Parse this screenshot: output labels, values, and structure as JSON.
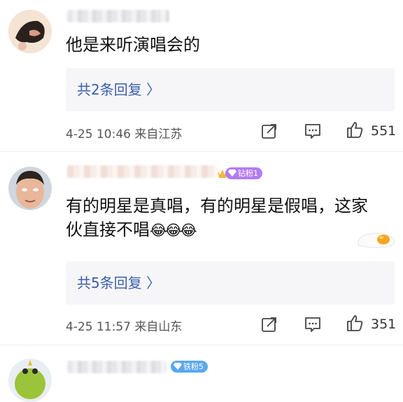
{
  "comments": [
    {
      "text": "他是来听演唱会的",
      "replies": "共2条回复 〉",
      "meta": "4-25 10:46 来自江苏",
      "likes": "551"
    },
    {
      "text_line1": "有的明星是真唱，有的明星是假唱，这家",
      "text_line2": "伙直接不唱",
      "emoji": "😂😂😂",
      "badge": "钻粉1",
      "replies": "共5条回复 〉",
      "meta": "4-25 11:57 来自山东",
      "likes": "351"
    },
    {
      "badge": "铁粉5"
    }
  ],
  "icons": [
    "share-icon",
    "comment-icon",
    "thumbs-up-icon",
    "crown-icon",
    "fried-egg-icon"
  ],
  "colors": {
    "link": "#3c5fa8",
    "reply_bg": "#f6f6f8",
    "badge_purple": "#b37cf0",
    "badge_blue": "#5aa8f0"
  }
}
